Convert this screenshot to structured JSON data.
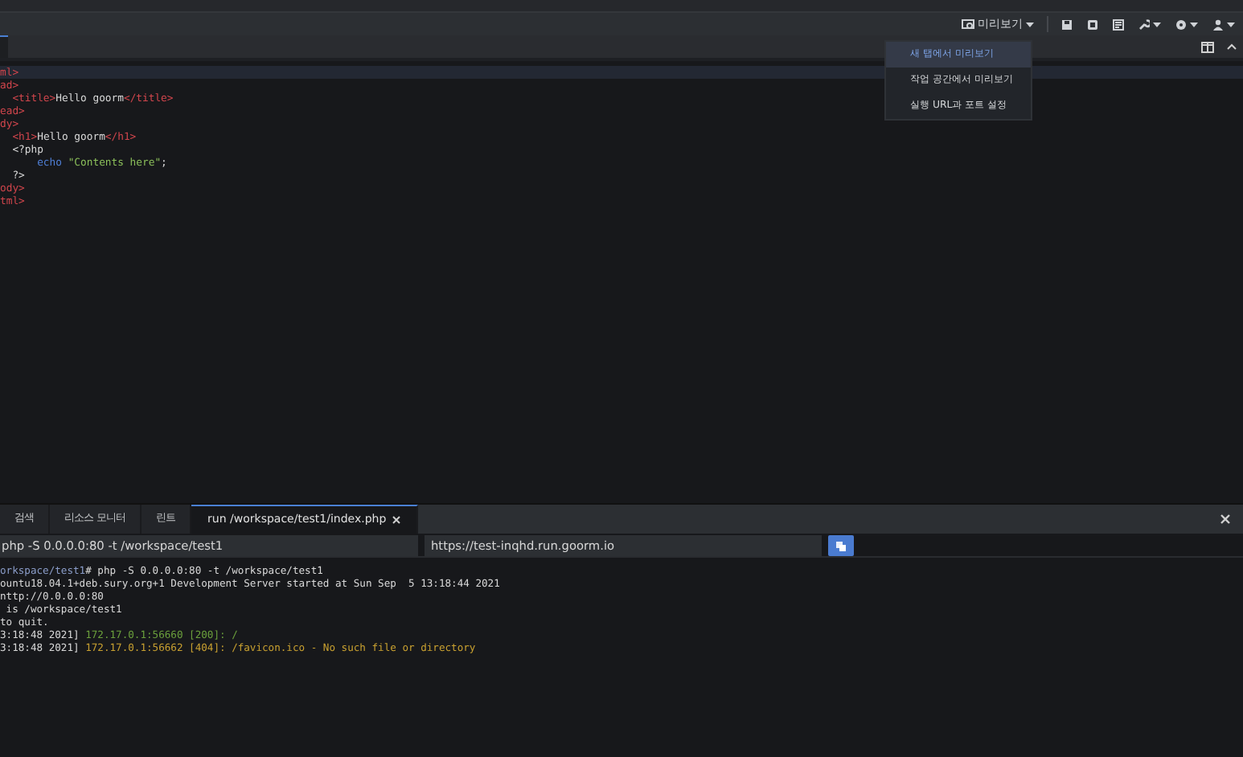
{
  "toolbar": {
    "preview_label": "미리보기"
  },
  "preview_menu": [
    {
      "label": "새 탭에서 미리보기",
      "selected": true
    },
    {
      "label": "작업 공간에서 미리보기",
      "selected": false
    },
    {
      "label": "실행 URL과 포트 설정",
      "selected": false
    }
  ],
  "editor": {
    "lines": [
      {
        "highlighted": true,
        "tokens": [
          {
            "text": "ml>",
            "kind": "tag"
          }
        ]
      },
      {
        "highlighted": false,
        "tokens": [
          {
            "text": "ad>",
            "kind": "tag"
          }
        ]
      },
      {
        "highlighted": false,
        "tokens": [
          {
            "text": "  <title>",
            "kind": "tag"
          },
          {
            "text": "Hello goorm",
            "kind": "plain"
          },
          {
            "text": "</title>",
            "kind": "tag"
          }
        ]
      },
      {
        "highlighted": false,
        "tokens": [
          {
            "text": "ead>",
            "kind": "tag"
          }
        ]
      },
      {
        "highlighted": false,
        "tokens": [
          {
            "text": "dy>",
            "kind": "tag"
          }
        ]
      },
      {
        "highlighted": false,
        "tokens": [
          {
            "text": "  <h1>",
            "kind": "tag"
          },
          {
            "text": "Hello goorm",
            "kind": "plain"
          },
          {
            "text": "</h1>",
            "kind": "tag"
          }
        ]
      },
      {
        "highlighted": false,
        "tokens": [
          {
            "text": "  <?php",
            "kind": "plain"
          }
        ]
      },
      {
        "highlighted": false,
        "tokens": [
          {
            "text": "      echo ",
            "kind": "keyword"
          },
          {
            "text": "\"Contents here\"",
            "kind": "string"
          },
          {
            "text": ";",
            "kind": "plain"
          }
        ]
      },
      {
        "highlighted": false,
        "tokens": [
          {
            "text": "  ?>",
            "kind": "plain"
          }
        ]
      },
      {
        "highlighted": false,
        "tokens": [
          {
            "text": "ody>",
            "kind": "tag"
          }
        ]
      },
      {
        "highlighted": false,
        "tokens": [
          {
            "text": "tml>",
            "kind": "tag"
          }
        ]
      }
    ]
  },
  "panel": {
    "tabs": [
      {
        "label": "검색",
        "selected": false,
        "closable": false
      },
      {
        "label": "리소스 모니터",
        "selected": false,
        "closable": false
      },
      {
        "label": "린트",
        "selected": false,
        "closable": false
      },
      {
        "label": "run /workspace/test1/index.php",
        "selected": true,
        "closable": true
      }
    ],
    "command": "php -S 0.0.0.0:80 -t /workspace/test1",
    "url": "https://test-inqhd.run.goorm.io",
    "terminal": [
      {
        "tokens": [
          {
            "text": "orkspace/test1",
            "kind": "prompt"
          },
          {
            "text": "# php -S 0.0.0.0:80 -t /workspace/test1",
            "kind": "plain"
          }
        ]
      },
      {
        "tokens": [
          {
            "text": "ountu18.04.1+deb.sury.org+1 Development Server started at Sun Sep  5 13:18:44 2021",
            "kind": "plain"
          }
        ]
      },
      {
        "tokens": [
          {
            "text": "nttp://0.0.0.0:80",
            "kind": "plain"
          }
        ]
      },
      {
        "tokens": [
          {
            "text": " is /workspace/test1",
            "kind": "plain"
          }
        ]
      },
      {
        "tokens": [
          {
            "text": "to quit.",
            "kind": "plain"
          }
        ]
      },
      {
        "tokens": [
          {
            "text": "3:18:48 2021] ",
            "kind": "plain"
          },
          {
            "text": "172.17.0.1:56660 [200]: /",
            "kind": "ok"
          }
        ]
      },
      {
        "tokens": [
          {
            "text": "3:18:48 2021] ",
            "kind": "plain"
          },
          {
            "text": "172.17.0.1:56662 [404]: /favicon.ico - No such file or directory",
            "kind": "warn"
          }
        ]
      }
    ]
  }
}
